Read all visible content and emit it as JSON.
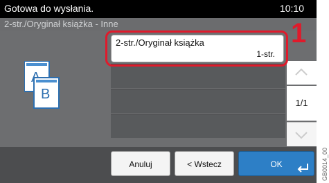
{
  "status": {
    "message": "Gotowa do wysłania.",
    "time": "10:10"
  },
  "title": "2-str./Oryginał książka - Inne",
  "list": {
    "selected_item": {
      "label": "2-str./Oryginał książka",
      "value": "1-str."
    }
  },
  "callout": {
    "number": "1",
    "color": "#e01a2b"
  },
  "pagination": {
    "indicator": "1/1"
  },
  "buttons": {
    "cancel": "Anuluj",
    "back": "< Wstecz",
    "ok": "OK"
  },
  "side_code": "GB0014_00",
  "colors": {
    "ok_button": "#2d7fc6",
    "accent_red": "#e01a2b"
  },
  "icons": [
    "document-a-b-icon",
    "chevron-up-icon",
    "chevron-down-icon",
    "enter-arrow-icon"
  ]
}
